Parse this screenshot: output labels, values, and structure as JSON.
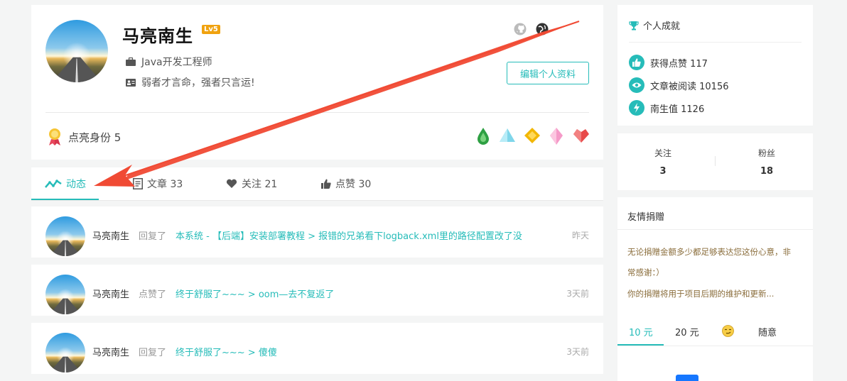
{
  "profile": {
    "name": "马亮南生",
    "level_badge": "Lv5",
    "job": "Java开发工程师",
    "motto": "弱者才言命，强者只言运!",
    "edit_button": "编辑个人资料",
    "identity_text": "点亮身份 5",
    "identity_gems": [
      "green-drop-gem-icon",
      "cyan-triangle-gem-icon",
      "gold-diamond-gem-icon",
      "pink-crystal-gem-icon",
      "red-heart-gem-icon"
    ]
  },
  "tabs": [
    {
      "label": "动态",
      "icon": "activity-line-icon",
      "active": true
    },
    {
      "label": "文章 33",
      "icon": "article-icon",
      "active": false
    },
    {
      "label": "关注 21",
      "icon": "heart-icon",
      "active": false
    },
    {
      "label": "点赞 30",
      "icon": "thumb-up-icon",
      "active": false
    }
  ],
  "feed": [
    {
      "user": "马亮南生",
      "action": "回复了",
      "target": "本系统 - 【后端】安装部署教程 > 报错的兄弟看下logback.xml里的路径配置改了没",
      "time": "昨天"
    },
    {
      "user": "马亮南生",
      "action": "点赞了",
      "target": "终于舒服了~~~ > oom—去不复返了",
      "time": "3天前"
    },
    {
      "user": "马亮南生",
      "action": "回复了",
      "target": "终于舒服了~~~ > 傻傻",
      "time": "3天前"
    }
  ],
  "achievements": {
    "title": "个人成就",
    "likes": "获得点赞 117",
    "reads": "文章被阅读 10156",
    "points": "南生值 1126"
  },
  "follow": {
    "following_label": "关注",
    "following_count": "3",
    "followers_label": "粉丝",
    "followers_count": "18"
  },
  "donate": {
    "title": "友情捐赠",
    "line1": "无论捐赠金额多少都足够表达您这份心意，非",
    "line2": "常感谢：）",
    "line3": "你的捐赠将用于项目后期的维护和更新...",
    "tabs": [
      "10 元",
      "20 元",
      "随意"
    ],
    "emoji_icon": "smirk-emoji-icon"
  },
  "colors": {
    "accent": "#26bcb9",
    "arrow": "#f04a34",
    "level_badge": "#f0a20f",
    "background": "#f4f5f5"
  }
}
